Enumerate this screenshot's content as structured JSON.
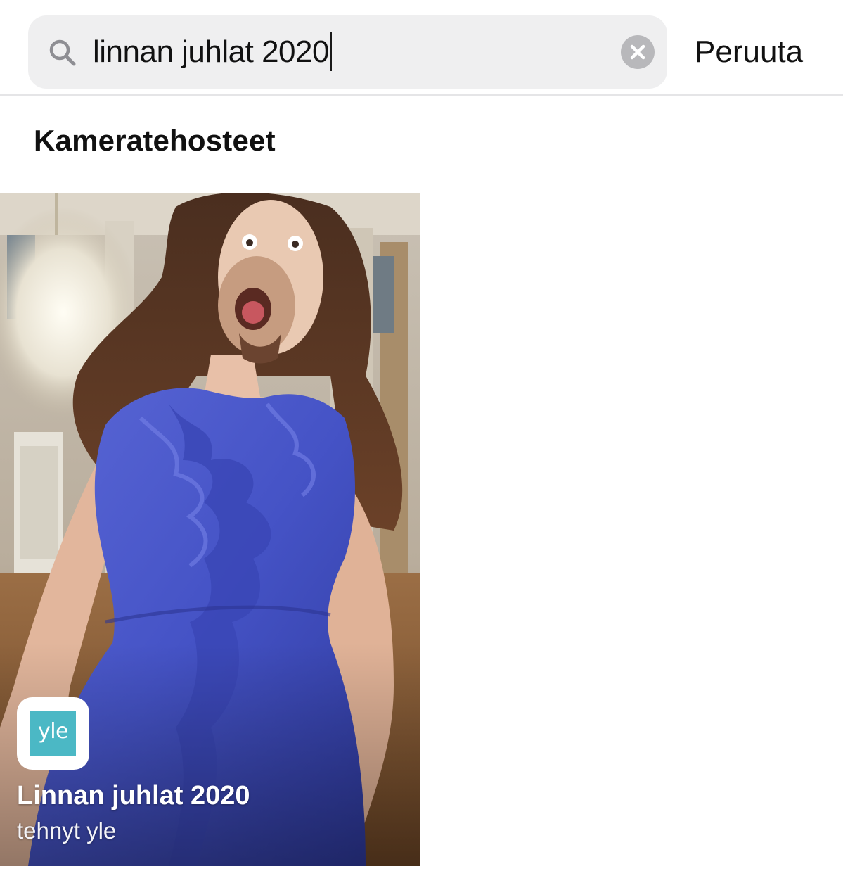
{
  "search": {
    "query": "linnan juhlat 2020",
    "cancel_label": "Peruuta"
  },
  "section": {
    "title": "Kameratehosteet"
  },
  "effects": [
    {
      "name": "Linnan juhlat 2020",
      "creator": "tehnyt yle",
      "creator_logo_text": "yle",
      "logo_color": "#4bb8c5"
    }
  ],
  "icons": {
    "search": "search-icon",
    "clear": "clear-icon"
  }
}
